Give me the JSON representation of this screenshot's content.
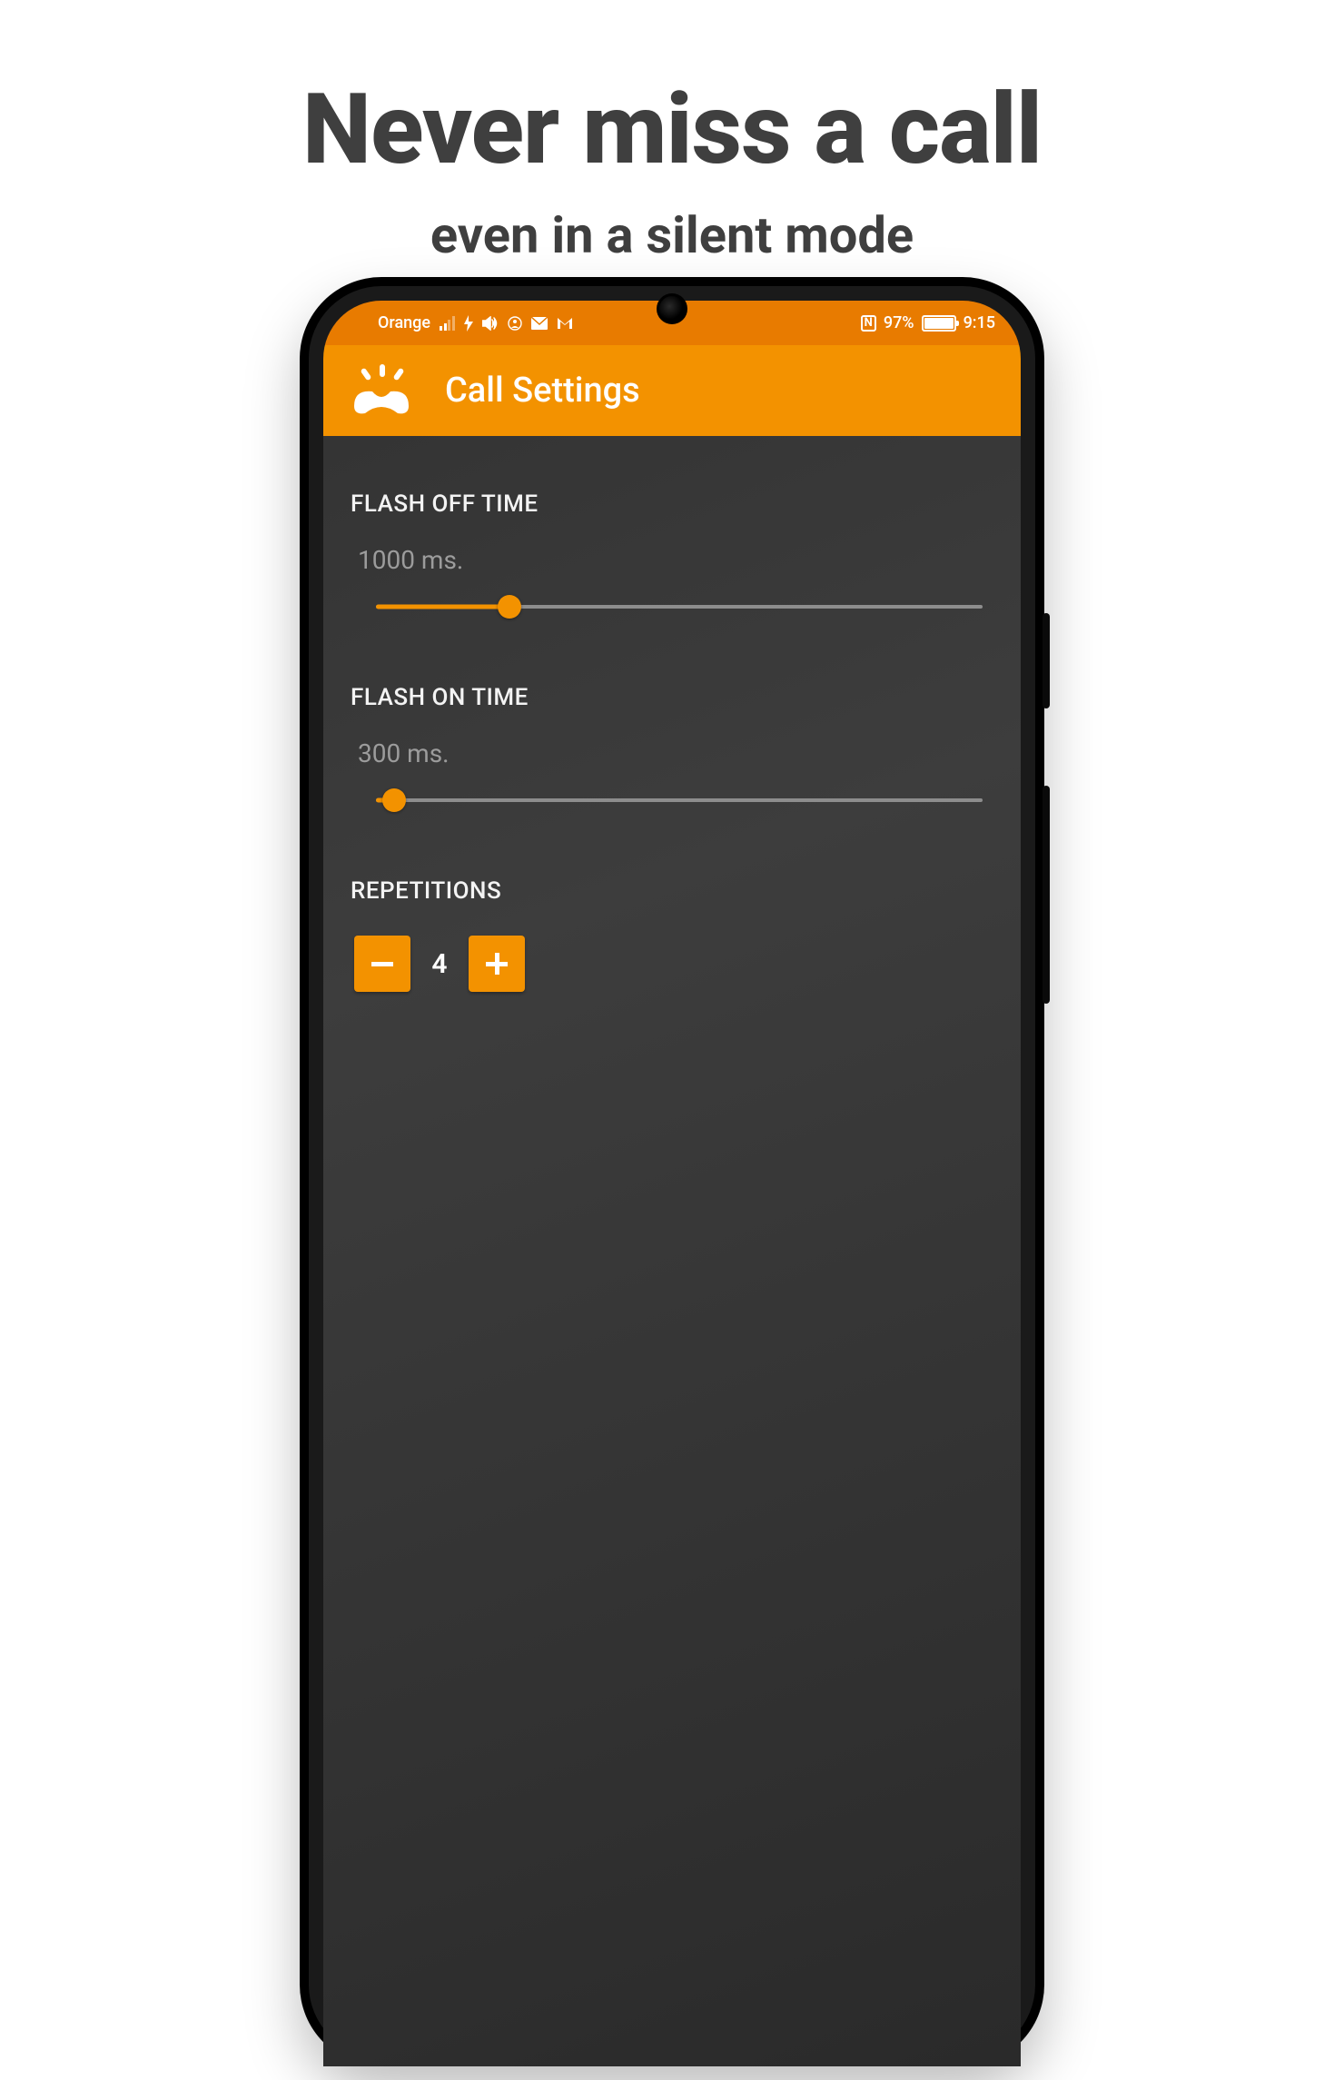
{
  "promo": {
    "headline": "Never miss a call",
    "subhead": "even in a silent mode"
  },
  "statusbar": {
    "carrier": "Orange",
    "battery_pct": "97%",
    "time": "9:15",
    "nfc_label": "N"
  },
  "appbar": {
    "title": "Call Settings",
    "icon_name": "flash-on-call-icon"
  },
  "sections": {
    "flash_off": {
      "label": "FLASH OFF TIME",
      "value_text": "1000 ms.",
      "pct": 22
    },
    "flash_on": {
      "label": "FLASH ON TIME",
      "value_text": "300 ms.",
      "pct": 3
    },
    "reps": {
      "label": "REPETITIONS",
      "value": "4"
    }
  },
  "colors": {
    "accent": "#f39200",
    "status": "#e87b00",
    "content_bg": "#343434"
  }
}
